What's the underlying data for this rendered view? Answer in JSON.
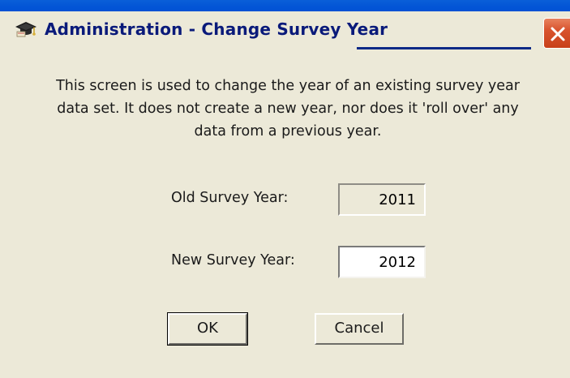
{
  "window": {
    "title": "Administration - Change Survey Year",
    "icon": "graduation-cap-icon",
    "close_icon": "close-icon"
  },
  "description": "This screen is used to change the year of an existing survey year data set. It does not create a new year, nor does it 'roll over' any data from a previous year.",
  "old_year": {
    "label": "Old Survey Year:",
    "value": "2011"
  },
  "new_year": {
    "label": "New Survey Year:",
    "value": "2012"
  },
  "buttons": {
    "ok": "OK",
    "cancel": "Cancel"
  },
  "colors": {
    "title_text": "#0a1a7a",
    "close_button": "#d8532e",
    "dialog_background": "#ece9d8"
  }
}
